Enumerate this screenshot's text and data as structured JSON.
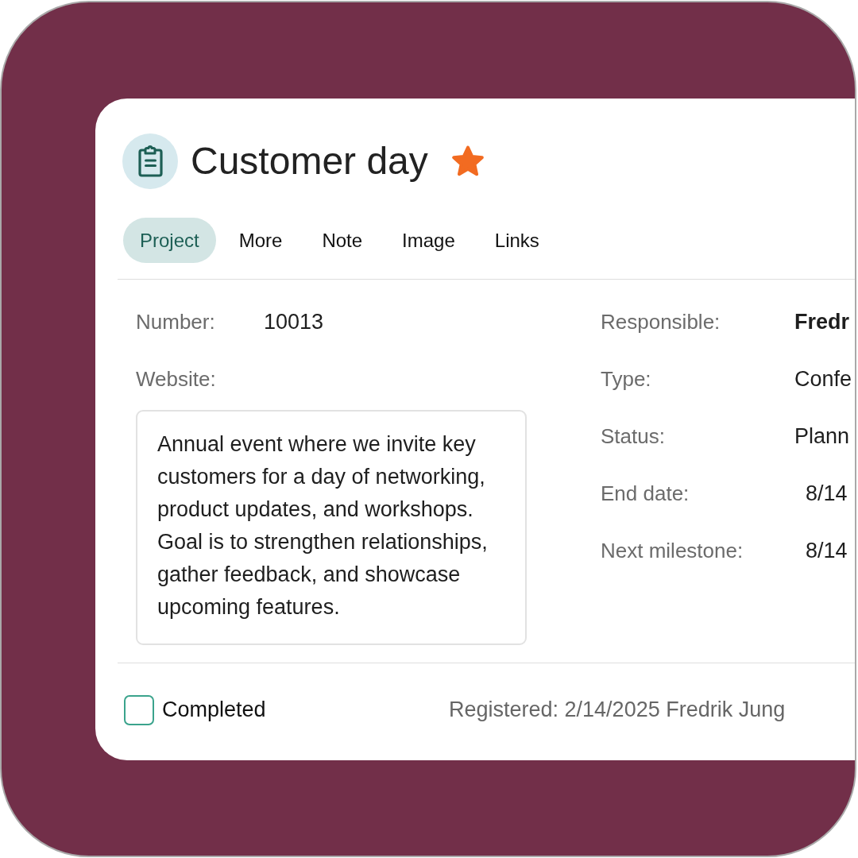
{
  "record": {
    "title": "Customer day",
    "favorite": true
  },
  "tabs": [
    {
      "label": "Project",
      "selected": true
    },
    {
      "label": "More",
      "selected": false
    },
    {
      "label": "Note",
      "selected": false
    },
    {
      "label": "Image",
      "selected": false
    },
    {
      "label": "Links",
      "selected": false
    }
  ],
  "left_fields": [
    {
      "label": "Number:",
      "value": "10013"
    },
    {
      "label": "Website:"
    }
  ],
  "description": "Annual event where we invite key customers for a day of networking, product updates, and workshops. Goal is to strengthen relationships, gather feedback, and showcase upcoming features.",
  "right_fields": [
    {
      "label": "Responsible:",
      "value": "Fredr",
      "kind": "person"
    },
    {
      "label": "Type:",
      "value": "Confe",
      "kind": "text"
    },
    {
      "label": "Status:",
      "value": "Plann",
      "kind": "text"
    },
    {
      "label": "End date:",
      "value": "8/14",
      "kind": "date"
    },
    {
      "label": "Next milestone:",
      "value": "8/14",
      "kind": "date"
    }
  ],
  "footer": {
    "completed": {
      "label": "Completed",
      "checked": false
    },
    "registered": "Registered: 2/14/2025 Fredrik Jung"
  }
}
